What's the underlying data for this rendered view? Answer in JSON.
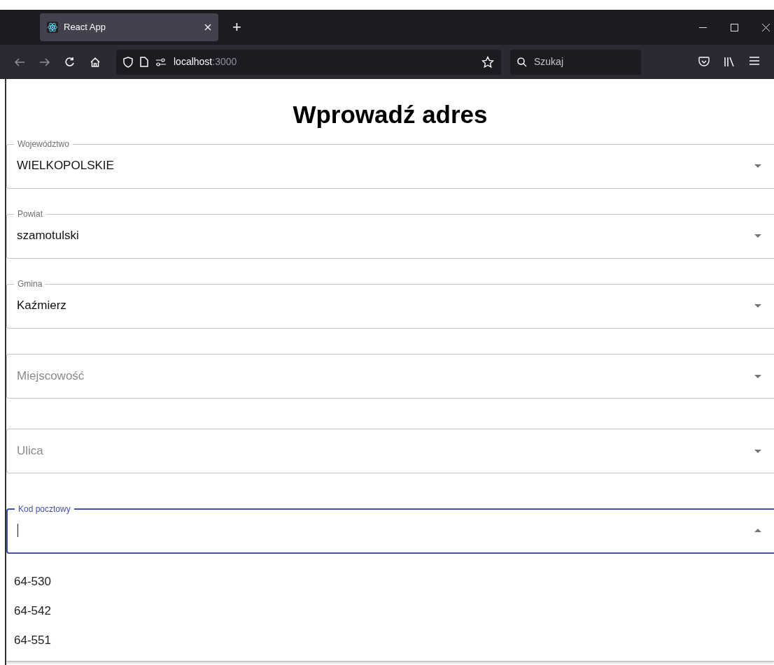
{
  "browser": {
    "tab_title": "React App",
    "new_tab": "+",
    "address_host": "localhost",
    "address_port": ":3000",
    "search_placeholder": "Szukaj"
  },
  "heading": "Wprowadź adres",
  "fields": [
    {
      "label": "Województwo",
      "value": "WIELKOPOLSKIE",
      "focused": false,
      "expanded": false
    },
    {
      "label": "Powiat",
      "value": "szamotulski",
      "focused": false,
      "expanded": false
    },
    {
      "label": "Gmina",
      "value": "Kaźmierz",
      "focused": false,
      "expanded": false
    },
    {
      "placeholder": "Miejscowość",
      "focused": false,
      "expanded": false
    },
    {
      "placeholder": "Ulica",
      "focused": false,
      "expanded": false
    },
    {
      "label": "Kod pocztowy",
      "focused": true,
      "expanded": true
    }
  ],
  "options": [
    "64-530",
    "64-542",
    "64-551"
  ]
}
